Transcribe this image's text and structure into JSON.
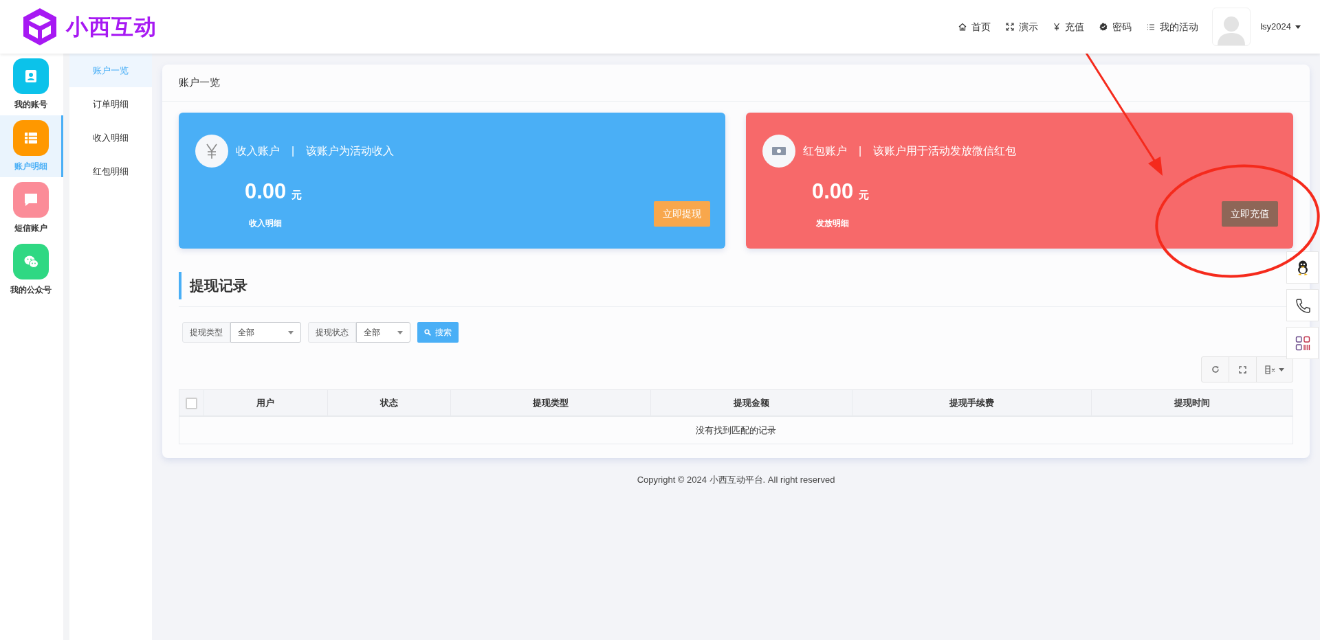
{
  "logo": {
    "text": "小西互动"
  },
  "nav": [
    {
      "label": "首页"
    },
    {
      "label": "演示"
    },
    {
      "label": "充值"
    },
    {
      "label": "密码"
    },
    {
      "label": "我的活动"
    }
  ],
  "user": {
    "name": "lsy2024"
  },
  "sidebar": {
    "items": [
      {
        "label": "我的账号",
        "color": "#0cc2ea",
        "selected": false
      },
      {
        "label": "账户明细",
        "color": "#ff9800",
        "selected": true
      },
      {
        "label": "短信账户",
        "color": "#fb8c98",
        "selected": false
      },
      {
        "label": "我的公众号",
        "color": "#2fd883",
        "selected": false
      }
    ]
  },
  "subnav": {
    "items": [
      {
        "label": "账户一览",
        "selected": true
      },
      {
        "label": "订单明细",
        "selected": false
      },
      {
        "label": "收入明细",
        "selected": false
      },
      {
        "label": "红包明细",
        "selected": false
      }
    ]
  },
  "page_title": "账户一览",
  "accounts": [
    {
      "color": "#4aaff6",
      "name": "收入账户",
      "separator": "|",
      "description": "该账户为活动收入",
      "amount": "0.00",
      "unit": "元",
      "link": "收入明细",
      "button": "立即提现"
    },
    {
      "color": "#f7696a",
      "name": "红包账户",
      "separator": "|",
      "description": "该账户用于活动发放微信红包",
      "amount": "0.00",
      "unit": "元",
      "link": "发放明细",
      "button": "立即充值"
    }
  ],
  "section_title": "提现记录",
  "filters": [
    {
      "label": "提现类型",
      "value": "全部"
    },
    {
      "label": "提现状态",
      "value": "全部"
    }
  ],
  "search_button": "搜索",
  "table": {
    "select_all_checked": false,
    "columns": [
      "用户",
      "状态",
      "提现类型",
      "提现金额",
      "提现手续费",
      "提现时间"
    ],
    "empty_message": "没有找到匹配的记录"
  },
  "footer": "Copyright © 2024 小西互动平台. All right reserved"
}
